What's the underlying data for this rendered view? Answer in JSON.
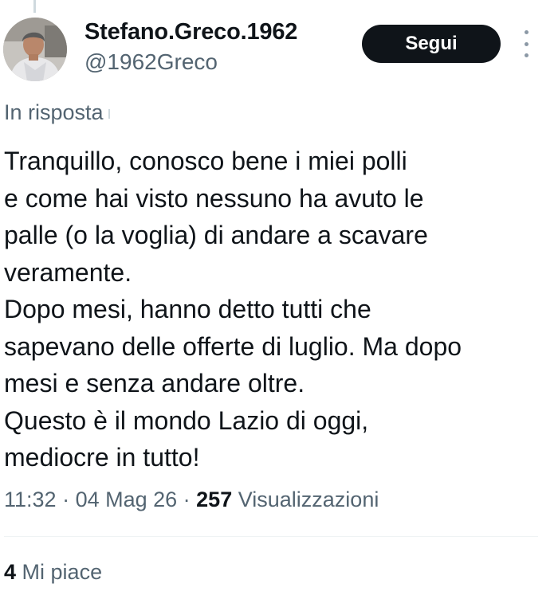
{
  "author": {
    "display_name": "Stefano.Greco.1962",
    "handle": "@1962Greco",
    "avatar_icon": "profile-photo"
  },
  "actions": {
    "follow_label": "Segui",
    "more_icon": "more-vertical-icon"
  },
  "reply_context": {
    "label": "In risposta"
  },
  "tweet": {
    "lines": [
      "Tranquillo, conosco bene i miei polli",
      "e come hai visto nessuno ha avuto le",
      "palle (o la voglia) di andare a scavare",
      "veramente.",
      "Dopo mesi, hanno detto tutti che",
      "sapevano delle offerte di luglio. Ma dopo",
      "mesi e senza andare oltre.",
      "Questo è il mondo Lazio di oggi,",
      "mediocre in tutto!"
    ]
  },
  "meta": {
    "time": "11:32",
    "separator": " · ",
    "date": "04 Mag 26",
    "views_count": "257",
    "views_label": "Visualizzazioni"
  },
  "engagement": {
    "likes_count": "4",
    "likes_label": "Mi piace"
  },
  "colors": {
    "text_primary": "#0f1419",
    "text_secondary": "#536471",
    "button_bg": "#0f1419",
    "button_text": "#ffffff",
    "divider": "#eff3f4"
  }
}
